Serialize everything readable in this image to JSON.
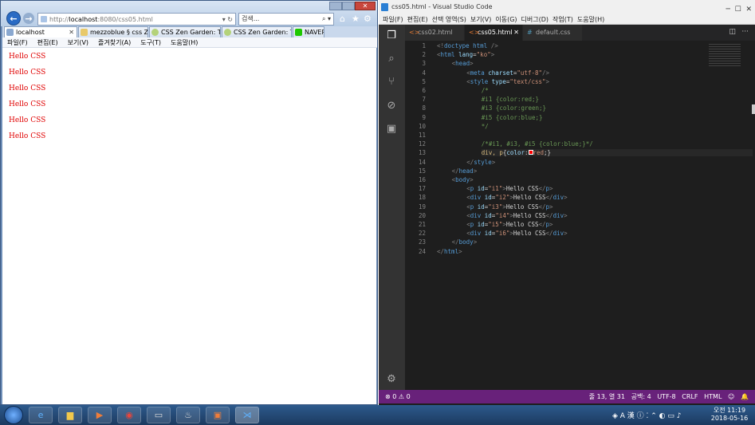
{
  "ie": {
    "address_prefix": "http://",
    "address_host": "localhost",
    "address_rest": ":8080/css05.html",
    "search_placeholder": "검색...",
    "tabs": [
      {
        "label": "localhost",
        "active": true
      },
      {
        "label": "mezzoblue § css Zen..."
      },
      {
        "label": "CSS Zen Garden: The..."
      },
      {
        "label": "CSS Zen Garden: The..."
      },
      {
        "label": "NAVER"
      }
    ],
    "menu": [
      "파일(F)",
      "편집(E)",
      "보기(V)",
      "즐겨찾기(A)",
      "도구(T)",
      "도움말(H)"
    ],
    "lines": [
      "Hello CSS",
      "Hello CSS",
      "Hello CSS",
      "Hello CSS",
      "Hello CSS",
      "Hello CSS"
    ]
  },
  "vscode": {
    "title": "css05.html - Visual Studio Code",
    "menu": [
      "파일(F)",
      "편집(E)",
      "선택 영역(S)",
      "보기(V)",
      "이동(G)",
      "디버그(D)",
      "작업(T)",
      "도움말(H)"
    ],
    "tabs": [
      {
        "label": "css02.html",
        "icon": "<>"
      },
      {
        "label": "css05.html",
        "icon": "<>",
        "active": true
      },
      {
        "label": "default.css",
        "icon": "#"
      }
    ],
    "status_left": "⊗ 0 ⚠ 0",
    "status_right": [
      "줄 13, 열 31",
      "공백: 4",
      "UTF-8",
      "CRLF",
      "HTML",
      "☺",
      "🔔"
    ]
  },
  "taskbar": {
    "time": "오전 11:19",
    "date": "2018-05-16"
  }
}
